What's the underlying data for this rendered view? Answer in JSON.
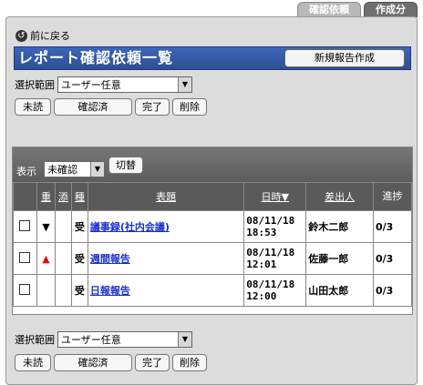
{
  "tabs": {
    "confirm": "確認依頼",
    "create": "作成分"
  },
  "back_label": "前に戻る",
  "page_title": "レポート確認依頼一覧",
  "new_report_button": "新規報告作成",
  "scope_label": "選択範囲",
  "scope_value": "ユーザー任意",
  "actions": {
    "unread": "未読",
    "confirmed": "確認済",
    "done": "完了",
    "delete": "削除"
  },
  "list": {
    "display_label": "表示",
    "filter_value": "未確認",
    "switch_button": "切替",
    "columns": {
      "importance": "重",
      "attach": "添",
      "kind": "種",
      "subject": "表題",
      "datetime": "日時▼",
      "sender": "差出人",
      "progress": "進捗"
    },
    "rows": [
      {
        "importance": "down",
        "kind": "受",
        "subject": "議事録(社内会議)",
        "date": "08/11/18",
        "time": "18:53",
        "sender": "鈴木二郎",
        "progress": "0/3"
      },
      {
        "importance": "up",
        "kind": "受",
        "subject": "週間報告",
        "date": "08/11/18",
        "time": "12:01",
        "sender": "佐藤一郎",
        "progress": "0/3"
      },
      {
        "importance": "",
        "kind": "受",
        "subject": "日報報告",
        "date": "08/11/18",
        "time": "12:00",
        "sender": "山田太郎",
        "progress": "0/3"
      }
    ]
  },
  "icons": {
    "back": "back-arrow-icon",
    "importance_down": "triangle-down-icon",
    "importance_up": "triangle-up-icon"
  },
  "colors": {
    "title_bar": "#2e4f96",
    "link": "#1a2fd0",
    "importance_up": "#e01010"
  }
}
